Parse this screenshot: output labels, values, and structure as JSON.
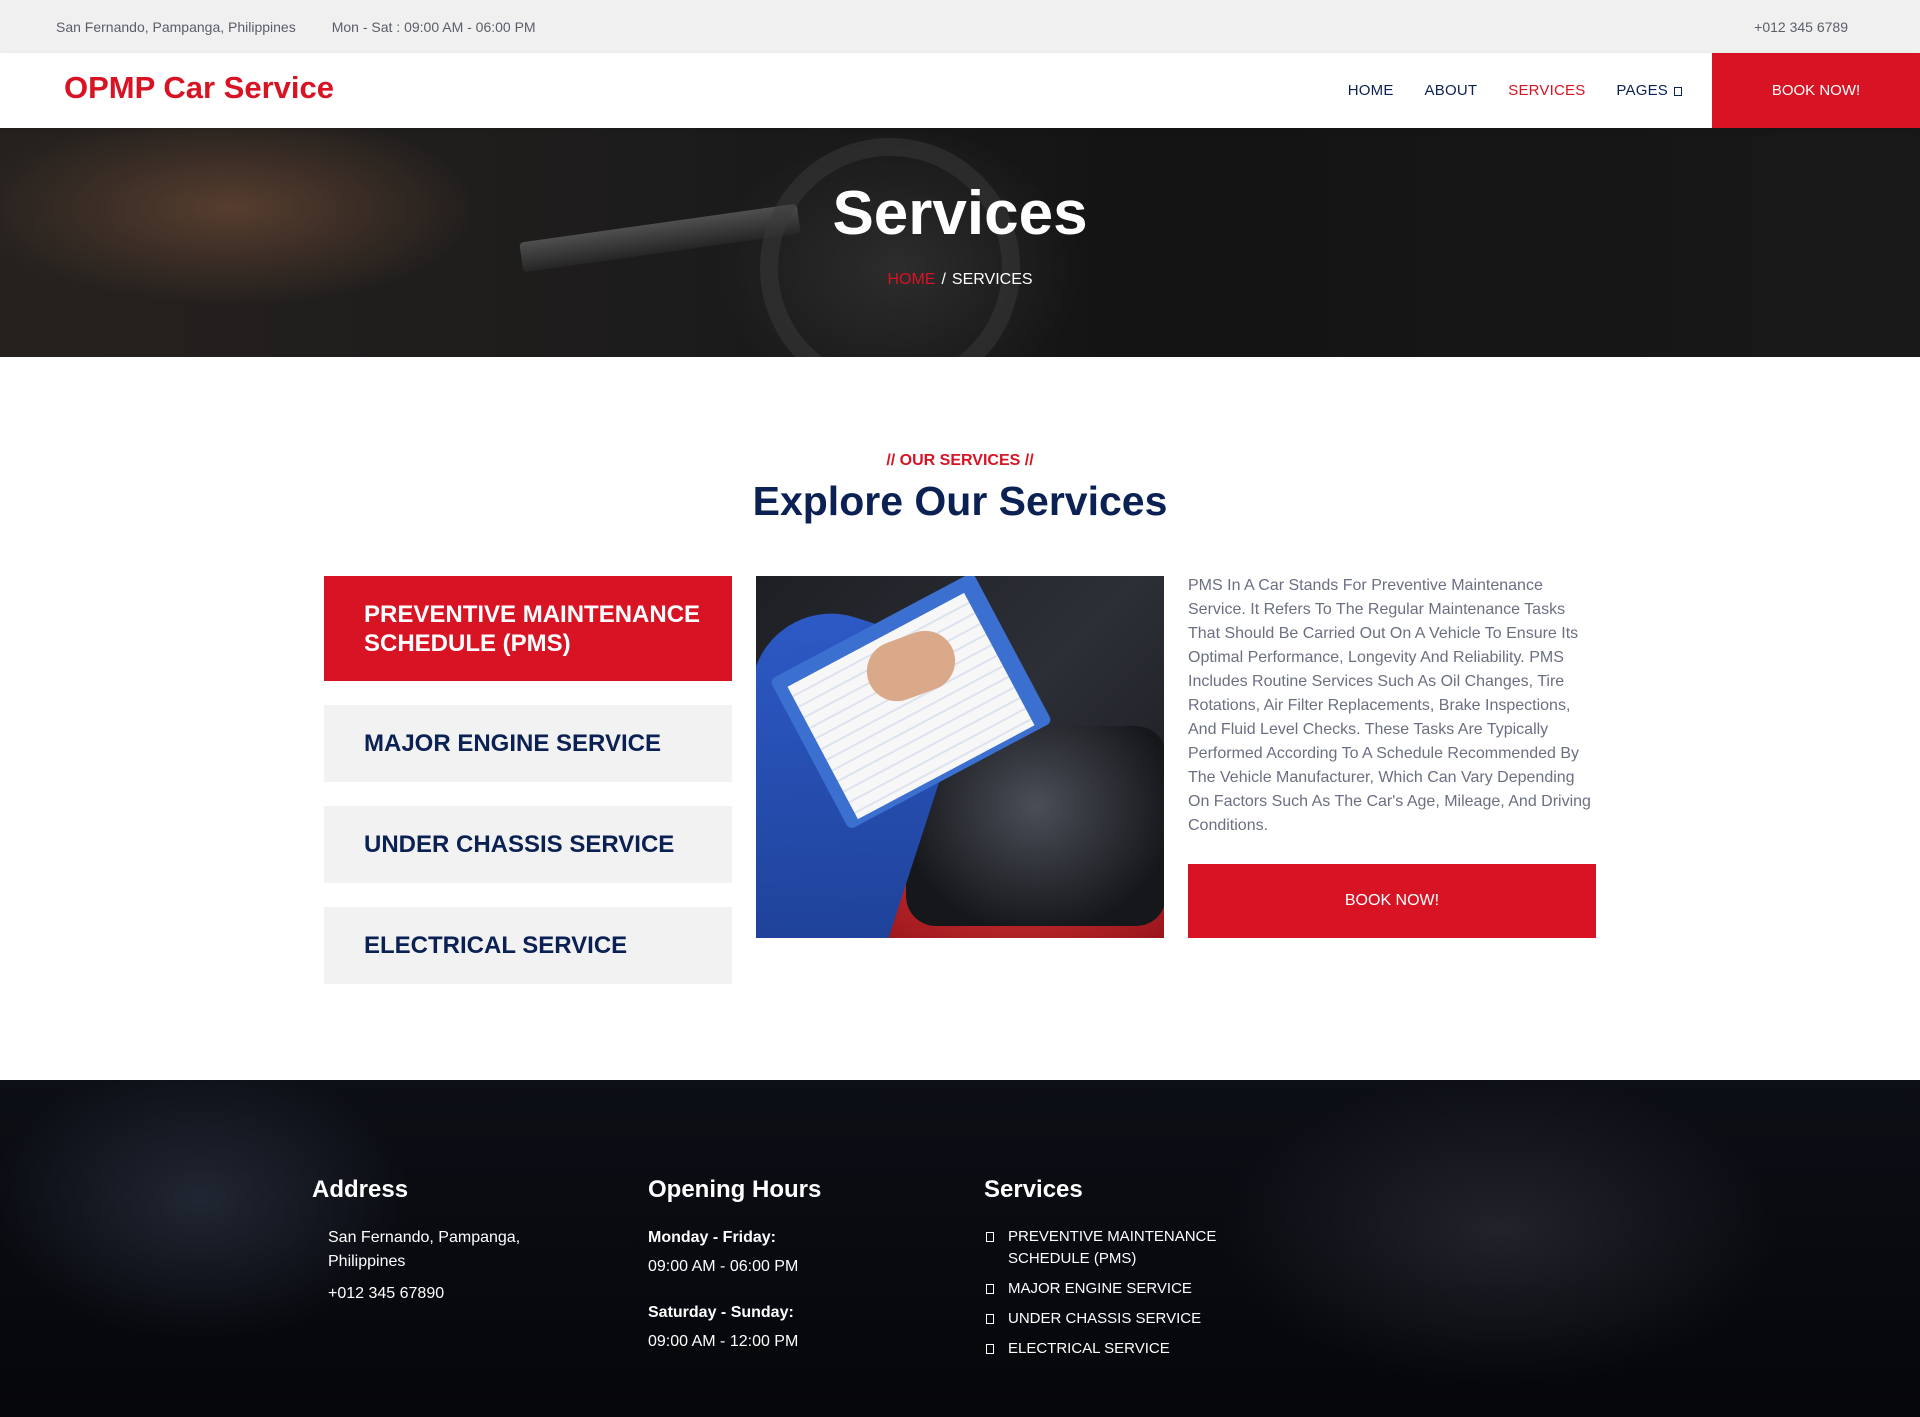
{
  "topbar": {
    "location": "San Fernando, Pampanga, Philippines",
    "hours": "Mon - Sat : 09:00 AM - 06:00 PM",
    "phone": "+012 345 6789"
  },
  "nav": {
    "brand": "OPMP Car Service",
    "links": [
      "HOME",
      "ABOUT",
      "SERVICES",
      "PAGES"
    ],
    "active": "SERVICES",
    "cta": "BOOK NOW!"
  },
  "hero": {
    "title": "Services",
    "breadcrumb_home": "HOME",
    "breadcrumb_sep": "/",
    "breadcrumb_current": "SERVICES"
  },
  "services": {
    "tag": "// OUR SERVICES //",
    "title": "Explore Our Services",
    "tabs": [
      "PREVENTIVE MAINTENANCE SCHEDULE (PMS)",
      "MAJOR ENGINE SERVICE",
      "UNDER CHASSIS SERVICE",
      "ELECTRICAL SERVICE"
    ],
    "description": "PMS In A Car Stands For Preventive Maintenance Service. It Refers To The Regular Maintenance Tasks That Should Be Carried Out On A Vehicle To Ensure Its Optimal Performance, Longevity And Reliability. PMS Includes Routine Services Such As Oil Changes, Tire Rotations, Air Filter Replacements, Brake Inspections, And Fluid Level Checks. These Tasks Are Typically Performed According To A Schedule Recommended By The Vehicle Manufacturer, Which Can Vary Depending On Factors Such As The Car's Age, Mileage, And Driving Conditions.",
    "cta": "BOOK NOW!"
  },
  "footer": {
    "address_title": "Address",
    "address_line": "San Fernando, Pampanga, Philippines",
    "address_phone": "+012 345 67890",
    "hours_title": "Opening Hours",
    "weekday_label": "Monday - Friday:",
    "weekday_hours": "09:00 AM - 06:00 PM",
    "weekend_label": "Saturday - Sunday:",
    "weekend_hours": "09:00 AM - 12:00 PM",
    "services_title": "Services",
    "services": [
      "PREVENTIVE MAINTENANCE SCHEDULE (PMS)",
      "MAJOR ENGINE SERVICE",
      "UNDER CHASSIS SERVICE",
      "ELECTRICAL SERVICE"
    ]
  },
  "colors": {
    "accent": "#d81324",
    "navy": "#0b2154",
    "light_gray": "#f2f2f2"
  }
}
